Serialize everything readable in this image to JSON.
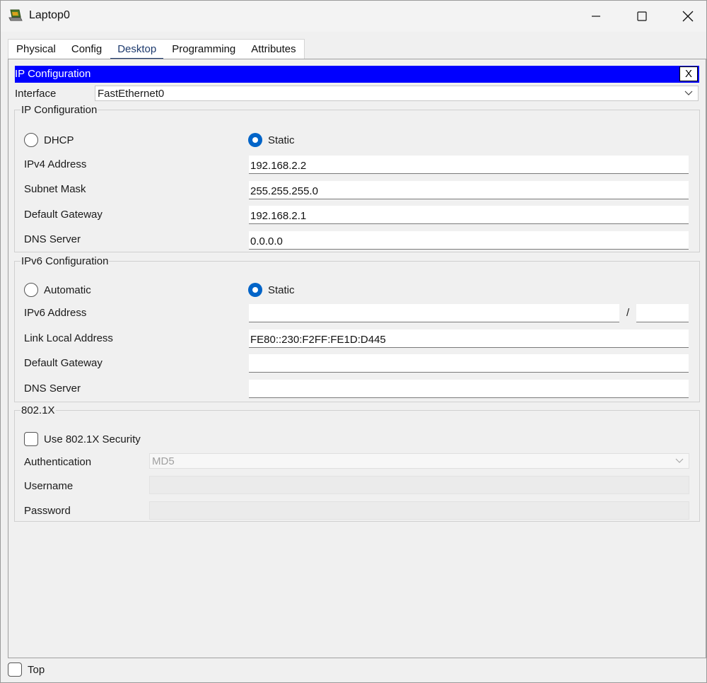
{
  "window": {
    "title": "Laptop0"
  },
  "tabs": [
    "Physical",
    "Config",
    "Desktop",
    "Programming",
    "Attributes"
  ],
  "active_tab": "Desktop",
  "ip_config_bar": {
    "title": "IP Configuration",
    "close_label": "X"
  },
  "interface": {
    "label": "Interface",
    "value": "FastEthernet0"
  },
  "ipv4": {
    "legend": "IP Configuration",
    "dhcp_label": "DHCP",
    "static_label": "Static",
    "selected": "Static",
    "ipv4_label": "IPv4 Address",
    "ipv4_value": "192.168.2.2",
    "subnet_label": "Subnet Mask",
    "subnet_value": "255.255.255.0",
    "gateway_label": "Default Gateway",
    "gateway_value": "192.168.2.1",
    "dns_label": "DNS Server",
    "dns_value": "0.0.0.0"
  },
  "ipv6": {
    "legend": "IPv6 Configuration",
    "auto_label": "Automatic",
    "static_label": "Static",
    "selected": "Static",
    "address_label": "IPv6 Address",
    "address_value": "",
    "prefix_separator": "/",
    "prefix_value": "",
    "link_local_label": "Link Local Address",
    "link_local_value": "FE80::230:F2FF:FE1D:D445",
    "gateway_label": "Default Gateway",
    "gateway_value": "",
    "dns_label": "DNS Server",
    "dns_value": ""
  },
  "dot1x": {
    "legend": "802.1X",
    "use_security_label": "Use 802.1X Security",
    "use_security_checked": false,
    "auth_label": "Authentication",
    "auth_value": "MD5",
    "username_label": "Username",
    "username_value": "",
    "password_label": "Password",
    "password_value": ""
  },
  "footer": {
    "top_label": "Top",
    "top_checked": false
  },
  "colors": {
    "ip_bar": "#0000ff",
    "radio_selected": "#0064c8",
    "active_tab_underline": "#1d3a6e"
  }
}
